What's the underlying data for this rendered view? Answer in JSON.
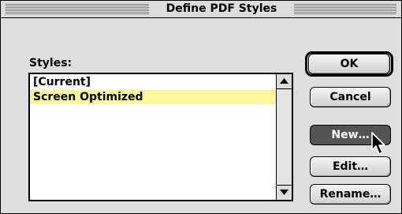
{
  "dialog": {
    "title": "Define PDF Styles",
    "styles_label": "Styles:",
    "styles": [
      {
        "label": "[Current]",
        "selected": false
      },
      {
        "label": "Screen Optimized",
        "selected": true
      }
    ],
    "buttons": {
      "ok": "OK",
      "cancel": "Cancel",
      "new": "New…",
      "edit": "Edit…",
      "rename": "Rename…"
    }
  },
  "colors": {
    "selection": "#fcf79a",
    "pressed_button": "#545454",
    "dialog_bg": "#dedede"
  },
  "icons": {
    "scroll_up": "scroll-up-arrow-icon",
    "scroll_down": "scroll-down-arrow-icon",
    "cursor": "mouse-pointer-icon"
  }
}
